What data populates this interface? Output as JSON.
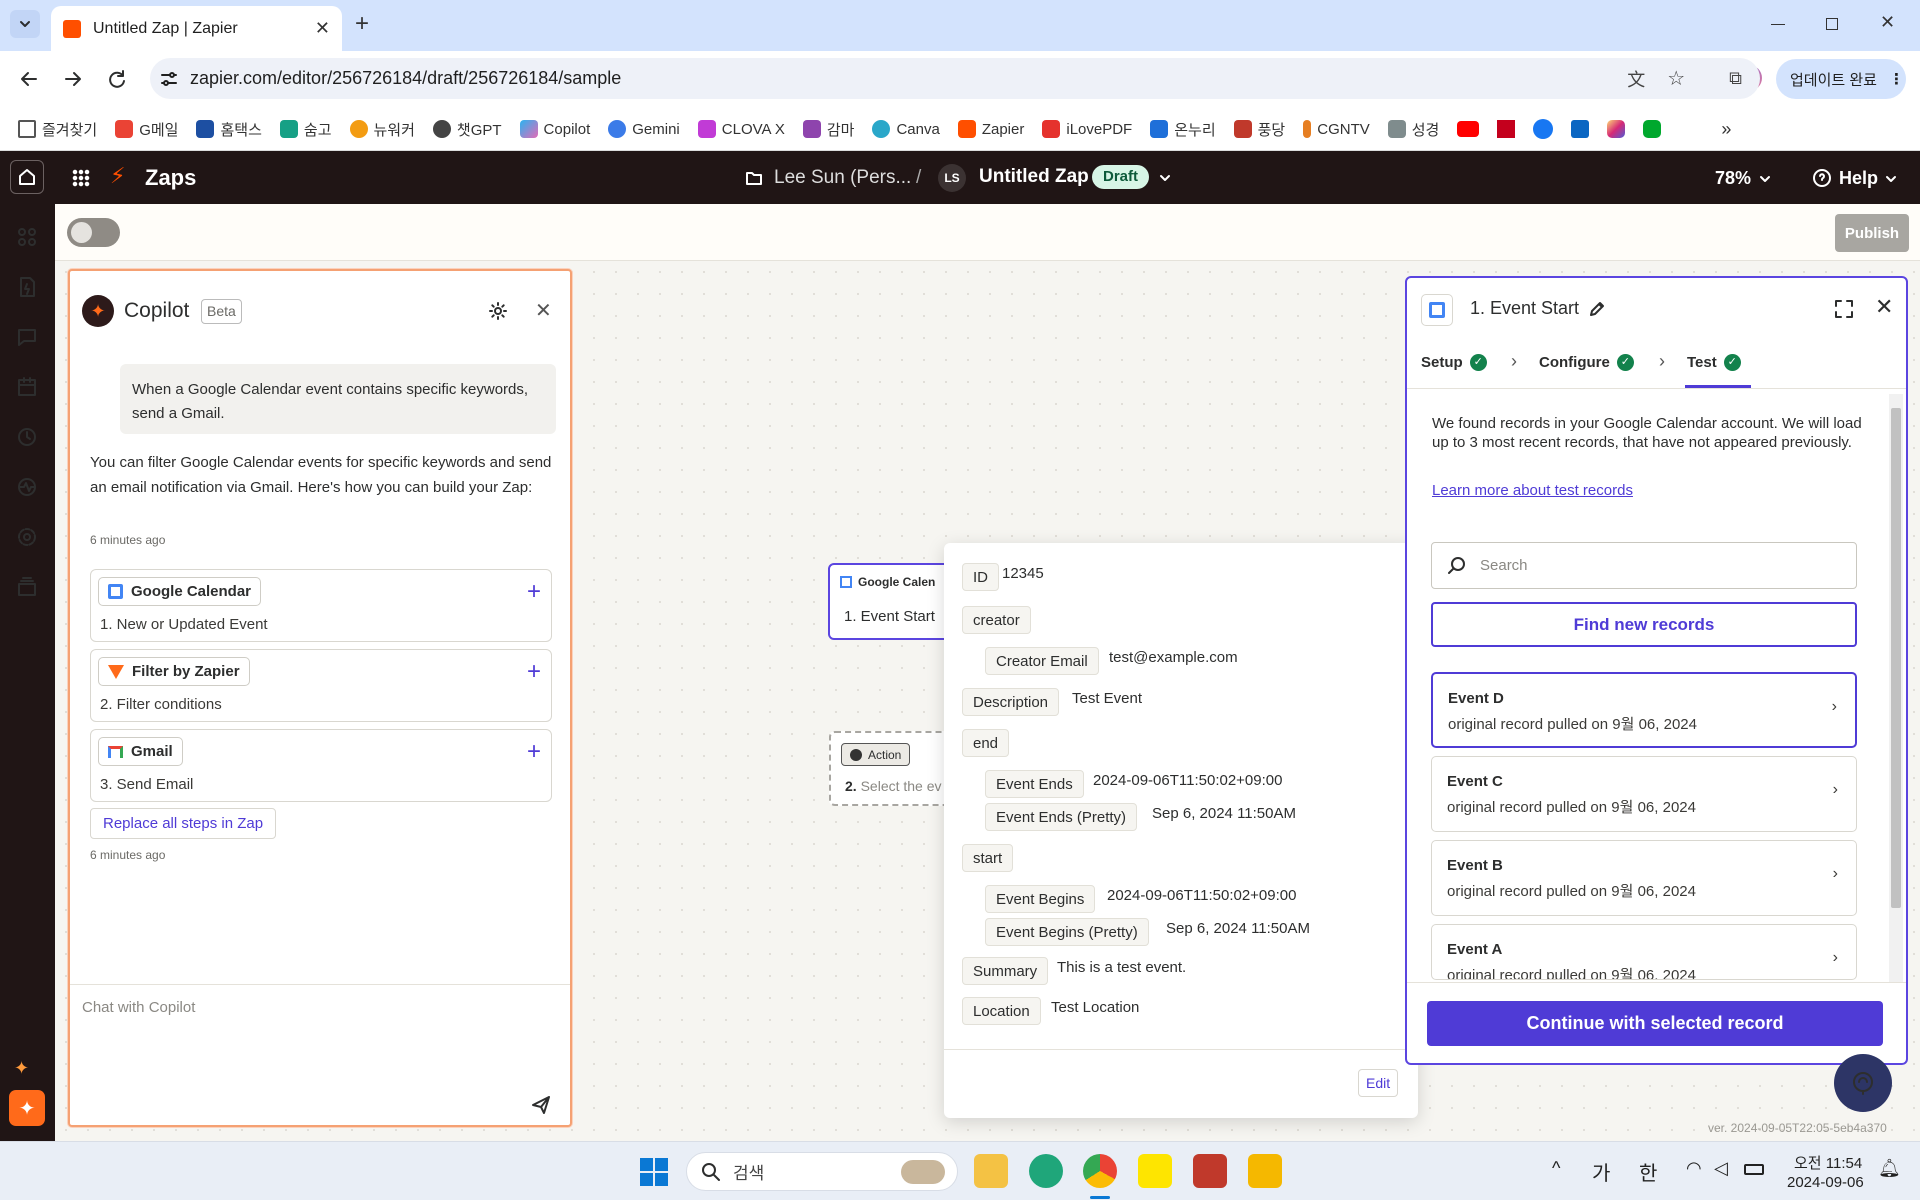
{
  "browser": {
    "tab_title": "Untitled Zap | Zapier",
    "url": "zapier.com/editor/256726184/draft/256726184/sample",
    "update_label": "업데이트 완료",
    "bookmarks": [
      "즐겨찾기",
      "G메일",
      "홈택스",
      "숨고",
      "뉴워커",
      "챗GPT",
      "Copilot",
      "Gemini",
      "CLOVA X",
      "감마",
      "Canva",
      "Zapier",
      "iLovePDF",
      "온누리",
      "풍당",
      "CGNTV",
      "성경"
    ]
  },
  "header": {
    "app": "Zaps",
    "folder": "Lee Sun (Pers...",
    "separator": "/",
    "avatar": "LS",
    "zap_title": "Untitled Zap",
    "status_badge": "Draft",
    "zoom": "78%",
    "help": "Help"
  },
  "toolbar": {
    "publish": "Publish"
  },
  "copilot": {
    "title": "Copilot",
    "beta": "Beta",
    "user_message": "When a Google Calendar event contains specific keywords, send a Gmail.",
    "reply": "You can filter Google Calendar events for specific keywords and send an email notification via Gmail. Here's how you can build your Zap:",
    "time1": "6 minutes ago",
    "steps": [
      {
        "app": "Google Calendar",
        "sub": "1. New or Updated Event"
      },
      {
        "app": "Filter by Zapier",
        "sub": "2. Filter conditions"
      },
      {
        "app": "Gmail",
        "sub": "3. Send Email"
      }
    ],
    "replace_label": "Replace all steps in Zap",
    "time2": "6 minutes ago",
    "chat_placeholder": "Chat with Copilot"
  },
  "canvas": {
    "node1_app": "Google Calen",
    "node1_step": "1. Event Start",
    "node2_tag": "Action",
    "node2_num": "2.",
    "node2_text": "Select the ev"
  },
  "record_popup": {
    "fields": [
      {
        "label": "ID",
        "value": "12345"
      },
      {
        "label": "creator",
        "value": ""
      },
      {
        "label": "Creator Email",
        "value": "test@example.com"
      },
      {
        "label": "Description",
        "value": "Test Event"
      },
      {
        "label": "end",
        "value": ""
      },
      {
        "label": "Event Ends",
        "value": "2024-09-06T11:50:02+09:00"
      },
      {
        "label": "Event Ends (Pretty)",
        "value": "Sep 6, 2024 11:50AM"
      },
      {
        "label": "start",
        "value": ""
      },
      {
        "label": "Event Begins",
        "value": "2024-09-06T11:50:02+09:00"
      },
      {
        "label": "Event Begins (Pretty)",
        "value": "Sep 6, 2024 11:50AM"
      },
      {
        "label": "Summary",
        "value": "This is a test event."
      },
      {
        "label": "Location",
        "value": "Test Location"
      }
    ],
    "edit": "Edit"
  },
  "panel": {
    "title": "1. Event Start",
    "tabs": [
      "Setup",
      "Configure",
      "Test"
    ],
    "intro": "We found records in your Google Calendar account. We will load up to 3 most recent records, that have not appeared previously.",
    "learn_more": "Learn more about test records",
    "search_placeholder": "Search",
    "find_new": "Find new records",
    "records": [
      {
        "name": "Event D",
        "sub": "original record pulled on 9월 06, 2024"
      },
      {
        "name": "Event C",
        "sub": "original record pulled on 9월 06, 2024"
      },
      {
        "name": "Event B",
        "sub": "original record pulled on 9월 06, 2024"
      },
      {
        "name": "Event A",
        "sub": "original record pulled on 9월 06, 2024"
      }
    ],
    "continue": "Continue with selected record"
  },
  "version": "ver. 2024-09-05T22:05-5eb4a370",
  "taskbar": {
    "search": "검색",
    "ime1": "가",
    "ime2": "한",
    "time": "오전 11:54",
    "date": "2024-09-06"
  }
}
